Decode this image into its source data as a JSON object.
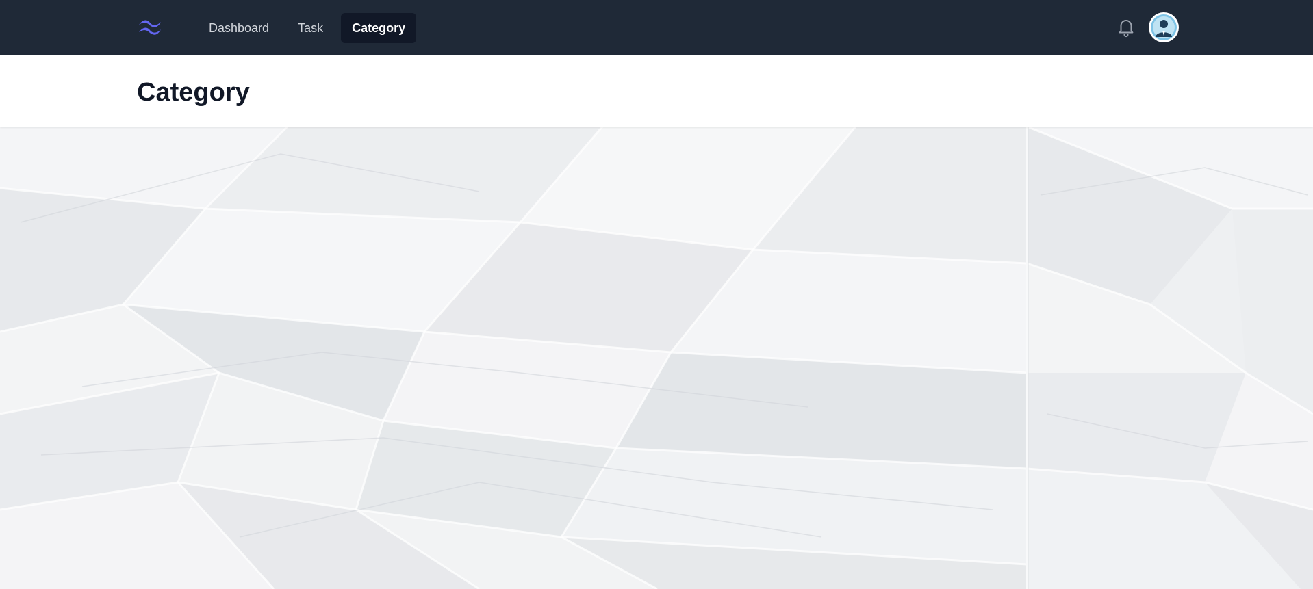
{
  "nav": {
    "logo_icon": "tailwind-wave-logo",
    "links": [
      {
        "label": "Dashboard",
        "active": false
      },
      {
        "label": "Task",
        "active": false
      },
      {
        "label": "Category",
        "active": true
      }
    ],
    "notification_icon": "bell-icon",
    "avatar_icon": "user-avatar"
  },
  "header": {
    "title": "Category"
  },
  "main": {
    "background": "crumpled-paper-texture"
  },
  "colors": {
    "navbar_bg": "#1f2937",
    "active_link_bg": "#111827",
    "logo_accent": "#6366f1",
    "title_text": "#111827"
  }
}
